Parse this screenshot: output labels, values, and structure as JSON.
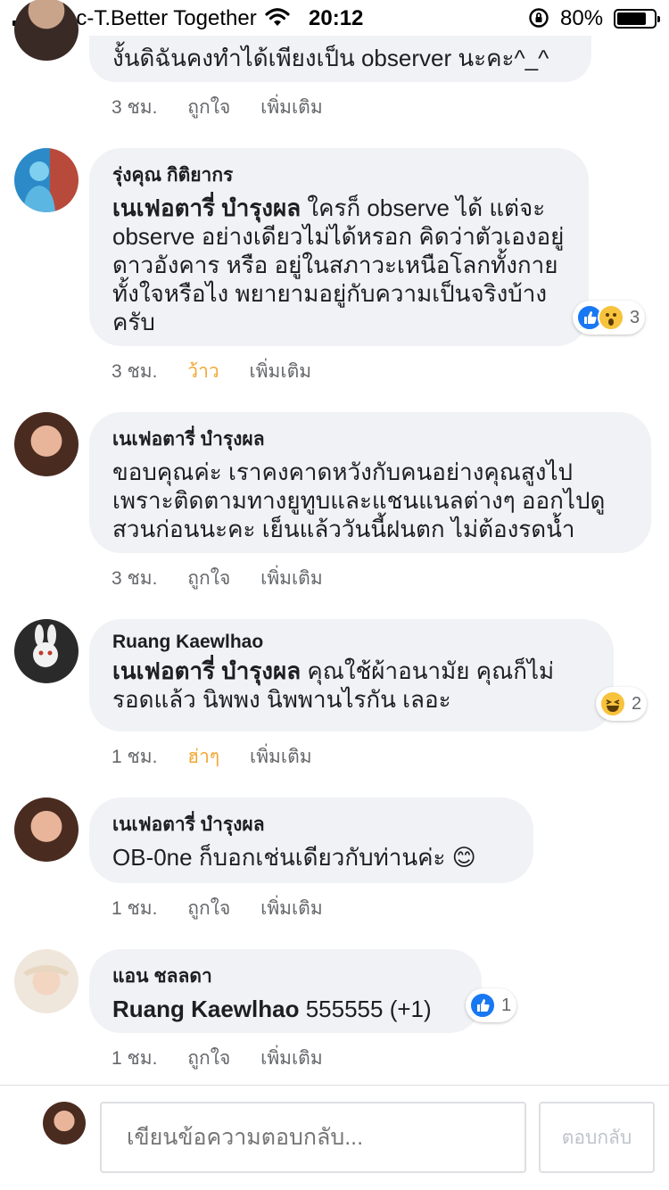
{
  "status_bar": {
    "carrier": "dtac-T.Better Together",
    "time": "20:12",
    "battery_percent": "80%",
    "battery_level": 0.8
  },
  "comments": [
    {
      "author": "",
      "mention": "",
      "text": "งั้นดิฉันคงทำได้เพียงเป็น observer นะคะ^_^",
      "time": "3 ชม.",
      "reaction_label": "ถูกใจ",
      "more": "เพิ่มเติม"
    },
    {
      "author": "รุ่งคุณ กิติยากร",
      "mention": "เนเฟอตารี่ บำรุงผล",
      "text": " ใครก็ observe ได้ แต่จะ observe อย่างเดียวไม่ได้หรอก คิดว่าตัวเองอยู่ดาวอังคาร หรือ อยู่ในสภาวะเหนือโลกทั้งกายทั้งใจหรือไง พยายามอยู่กับความเป็นจริงบ้างครับ",
      "time": "3 ชม.",
      "reaction_label": "ว้าว",
      "more": "เพิ่มเติม",
      "reaction_icons": [
        "like-icon",
        "wow-icon"
      ],
      "reaction_count": "3"
    },
    {
      "author": "เนเฟอตารี่ บำรุงผล",
      "mention": "",
      "text": "ขอบคุณค่ะ เราคงคาดหวังกับคนอย่างคุณสูงไป เพราะติดตามทางยูทูบและแชนแนลต่างๆ ออกไปดูสวนก่อนนะคะ เย็นแล้ววันนี้ฝนตก ไม่ต้องรดน้ำ",
      "time": "3 ชม.",
      "reaction_label": "ถูกใจ",
      "more": "เพิ่มเติม"
    },
    {
      "author": "Ruang Kaewlhao",
      "mention": "เนเฟอตารี่ บำรุงผล",
      "text": " คุณใช้ผ้าอนามัย คุณก็ไม่รอดแล้ว นิพพง นิพพานไรกัน เลอะ",
      "time": "1 ชม.",
      "reaction_label": "ฮ่าๆ",
      "more": "เพิ่มเติม",
      "reaction_icons": [
        "haha-icon"
      ],
      "reaction_count": "2"
    },
    {
      "author": "เนเฟอตารี่ บำรุงผล",
      "mention": "",
      "text": "OB-0ne ก็บอกเช่นเดียวกับท่านค่ะ 😊",
      "time": "1 ชม.",
      "reaction_label": "ถูกใจ",
      "more": "เพิ่มเติม"
    },
    {
      "author": "แอน ชลลดา",
      "mention": "Ruang Kaewlhao",
      "text": " 555555 (+1)",
      "time": "1 ชม.",
      "reaction_label": "ถูกใจ",
      "more": "เพิ่มเติม",
      "reaction_icons": [
        "like-icon"
      ],
      "reaction_count": "1"
    }
  ],
  "composer": {
    "placeholder": "เขียนข้อความตอบกลับ...",
    "send_label": "ตอบกลับ"
  }
}
